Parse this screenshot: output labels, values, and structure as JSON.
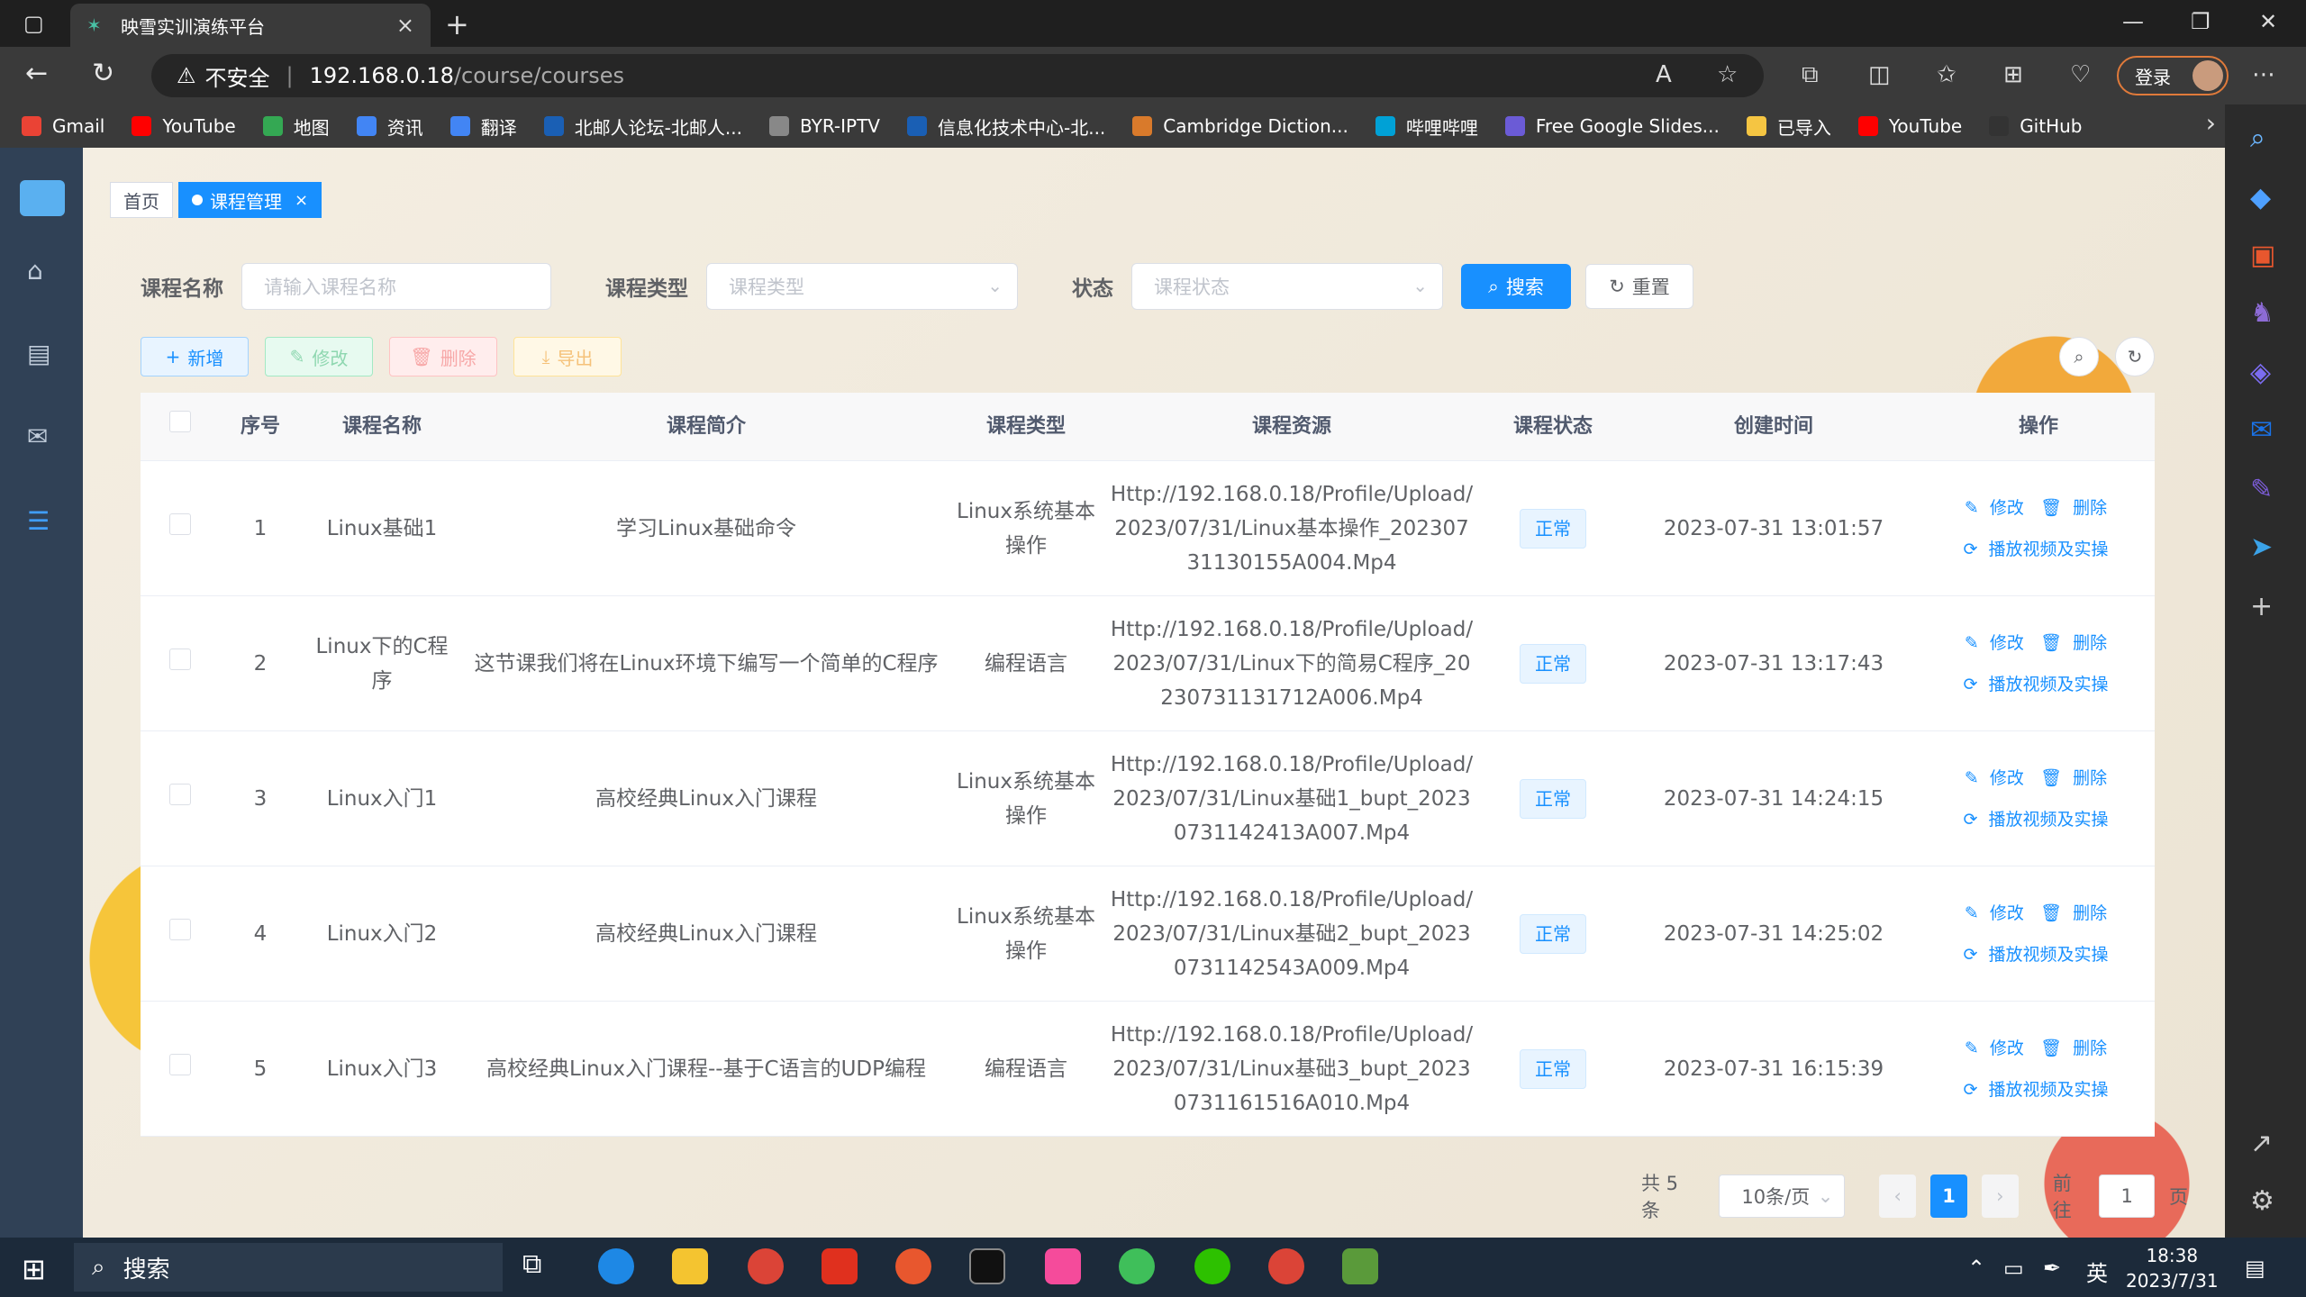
{
  "browser": {
    "tab_title": "映雪实训演练平台",
    "tab_close": "×",
    "new_tab": "+",
    "security_label": "不安全",
    "url_host": "192.168.0.18",
    "url_path": "/course/courses",
    "login_label": "登录",
    "bookmarks": [
      {
        "label": "Gmail",
        "color": "#ea4335"
      },
      {
        "label": "YouTube",
        "color": "#ff0000"
      },
      {
        "label": "地图",
        "color": "#34a853"
      },
      {
        "label": "资讯",
        "color": "#4285f4"
      },
      {
        "label": "翻译",
        "color": "#4285f4"
      },
      {
        "label": "北邮人论坛-北邮人...",
        "color": "#1a5fb4"
      },
      {
        "label": "BYR-IPTV",
        "color": "#888888"
      },
      {
        "label": "信息化技术中心-北...",
        "color": "#1a5fb4"
      },
      {
        "label": "Cambridge Diction...",
        "color": "#d97a2b"
      },
      {
        "label": "哔哩哔哩",
        "color": "#00a1d6"
      },
      {
        "label": "Free Google Slides...",
        "color": "#6b5bd6"
      },
      {
        "label": "已导入",
        "color": "#f5c542"
      },
      {
        "label": "YouTube",
        "color": "#ff0000"
      },
      {
        "label": "GitHub",
        "color": "#333333"
      }
    ]
  },
  "page": {
    "tags": {
      "home": "首页",
      "current": "课程管理",
      "close": "×"
    },
    "search": {
      "name_label": "课程名称",
      "name_placeholder": "请输入课程名称",
      "type_label": "课程类型",
      "type_placeholder": "课程类型",
      "status_label": "状态",
      "status_placeholder": "课程状态",
      "search_btn": "搜索",
      "reset_btn": "重置"
    },
    "actions": {
      "add": "新增",
      "edit": "修改",
      "delete": "删除",
      "export": "导出"
    },
    "table": {
      "headers": [
        "序号",
        "课程名称",
        "课程简介",
        "课程类型",
        "课程资源",
        "课程状态",
        "创建时间",
        "操作"
      ],
      "rows": [
        {
          "no": "1",
          "name": "Linux基础1",
          "intro": "学习Linux基础命令",
          "type": "Linux系统基本操作",
          "resource": "Http://192.168.0.18/Profile/Upload/2023/07/31/Linux基本操作_20230731130155A004.Mp4",
          "status": "正常",
          "created": "2023-07-31 13:01:57"
        },
        {
          "no": "2",
          "name": "Linux下的C程序",
          "intro": "这节课我们将在Linux环境下编写一个简单的C程序",
          "type": "编程语言",
          "resource": "Http://192.168.0.18/Profile/Upload/2023/07/31/Linux下的简易C程序_20230731131712A006.Mp4",
          "status": "正常",
          "created": "2023-07-31 13:17:43"
        },
        {
          "no": "3",
          "name": "Linux入门1",
          "intro": "高校经典Linux入门课程",
          "type": "Linux系统基本操作",
          "resource": "Http://192.168.0.18/Profile/Upload/2023/07/31/Linux基础1_bupt_20230731142413A007.Mp4",
          "status": "正常",
          "created": "2023-07-31 14:24:15"
        },
        {
          "no": "4",
          "name": "Linux入门2",
          "intro": "高校经典Linux入门课程",
          "type": "Linux系统基本操作",
          "resource": "Http://192.168.0.18/Profile/Upload/2023/07/31/Linux基础2_bupt_20230731142543A009.Mp4",
          "status": "正常",
          "created": "2023-07-31 14:25:02"
        },
        {
          "no": "5",
          "name": "Linux入门3",
          "intro": "高校经典Linux入门课程--基于C语言的UDP编程",
          "type": "编程语言",
          "resource": "Http://192.168.0.18/Profile/Upload/2023/07/31/Linux基础3_bupt_20230731161516A010.Mp4",
          "status": "正常",
          "created": "2023-07-31 16:15:39"
        }
      ],
      "op_edit": "修改",
      "op_delete": "删除",
      "op_play": "播放视频及实操"
    },
    "pagination": {
      "total": "共 5 条",
      "page_size": "10条/页",
      "current_page": "1",
      "goto_label": "前往",
      "goto_value": "1",
      "page_unit": "页"
    }
  },
  "taskbar": {
    "search_label": "搜索",
    "ime": "英",
    "time": "18:38",
    "date": "2023/7/31"
  },
  "colors": {
    "primary": "#1890ff",
    "sidebar": "#304156"
  }
}
